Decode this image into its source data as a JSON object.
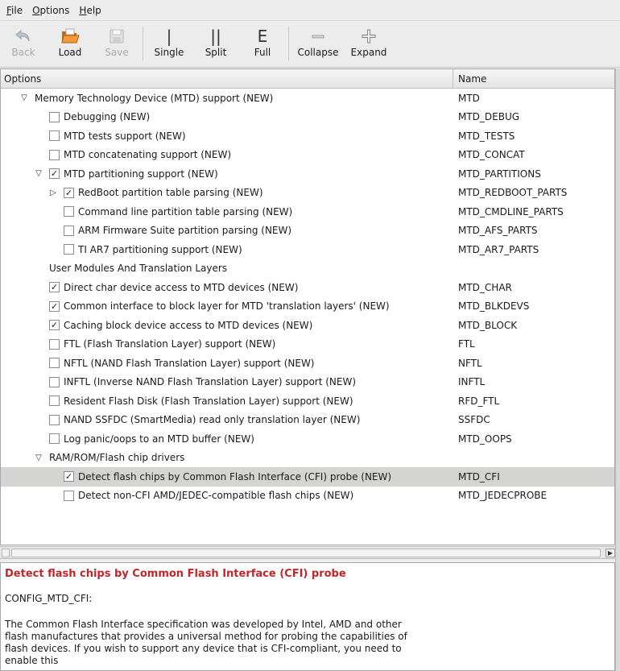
{
  "menubar": {
    "items": [
      {
        "pre": "",
        "u": "F",
        "post": "ile"
      },
      {
        "pre": "",
        "u": "O",
        "post": "ptions"
      },
      {
        "pre": "",
        "u": "H",
        "post": "elp"
      }
    ]
  },
  "toolbar": {
    "back": "Back",
    "load": "Load",
    "save": "Save",
    "single": "Single",
    "split": "Split",
    "full": "Full",
    "collapse": "Collapse",
    "expand": "Expand"
  },
  "tree": {
    "col_options": "Options",
    "col_name": "Name",
    "rows": [
      {
        "label": "Memory Technology Device (MTD) support (NEW)",
        "name": "MTD",
        "indent": 0,
        "expander": "down",
        "checkbox": "none"
      },
      {
        "label": "Debugging (NEW)",
        "name": "MTD_DEBUG",
        "indent": 1,
        "expander": "none",
        "checkbox": "unchecked"
      },
      {
        "label": "MTD tests support (NEW)",
        "name": "MTD_TESTS",
        "indent": 1,
        "expander": "none",
        "checkbox": "unchecked"
      },
      {
        "label": "MTD concatenating support (NEW)",
        "name": "MTD_CONCAT",
        "indent": 1,
        "expander": "none",
        "checkbox": "unchecked"
      },
      {
        "label": "MTD partitioning support (NEW)",
        "name": "MTD_PARTITIONS",
        "indent": 1,
        "expander": "down",
        "checkbox": "checked"
      },
      {
        "label": "RedBoot partition table parsing (NEW)",
        "name": "MTD_REDBOOT_PARTS",
        "indent": 2,
        "expander": "right",
        "checkbox": "checked"
      },
      {
        "label": "Command line partition table parsing (NEW)",
        "name": "MTD_CMDLINE_PARTS",
        "indent": 2,
        "expander": "none",
        "checkbox": "unchecked"
      },
      {
        "label": "ARM Firmware Suite partition parsing (NEW)",
        "name": "MTD_AFS_PARTS",
        "indent": 2,
        "expander": "none",
        "checkbox": "unchecked"
      },
      {
        "label": "TI AR7 partitioning support (NEW)",
        "name": "MTD_AR7_PARTS",
        "indent": 2,
        "expander": "none",
        "checkbox": "unchecked"
      },
      {
        "label": "User Modules And Translation Layers",
        "name": "",
        "indent": 1,
        "expander": "none",
        "checkbox": "none"
      },
      {
        "label": "Direct char device access to MTD devices (NEW)",
        "name": "MTD_CHAR",
        "indent": 1,
        "expander": "none",
        "checkbox": "checked"
      },
      {
        "label": "Common interface to block layer for MTD 'translation layers' (NEW)",
        "name": "MTD_BLKDEVS",
        "indent": 1,
        "expander": "none",
        "checkbox": "checked"
      },
      {
        "label": "Caching block device access to MTD devices (NEW)",
        "name": "MTD_BLOCK",
        "indent": 1,
        "expander": "none",
        "checkbox": "checked"
      },
      {
        "label": "FTL (Flash Translation Layer) support (NEW)",
        "name": "FTL",
        "indent": 1,
        "expander": "none",
        "checkbox": "unchecked"
      },
      {
        "label": "NFTL (NAND Flash Translation Layer) support (NEW)",
        "name": "NFTL",
        "indent": 1,
        "expander": "none",
        "checkbox": "unchecked"
      },
      {
        "label": "INFTL (Inverse NAND Flash Translation Layer) support (NEW)",
        "name": "INFTL",
        "indent": 1,
        "expander": "none",
        "checkbox": "unchecked"
      },
      {
        "label": "Resident Flash Disk (Flash Translation Layer) support (NEW)",
        "name": "RFD_FTL",
        "indent": 1,
        "expander": "none",
        "checkbox": "unchecked"
      },
      {
        "label": "NAND SSFDC (SmartMedia) read only translation layer (NEW)",
        "name": "SSFDC",
        "indent": 1,
        "expander": "none",
        "checkbox": "unchecked"
      },
      {
        "label": "Log panic/oops to an MTD buffer (NEW)",
        "name": "MTD_OOPS",
        "indent": 1,
        "expander": "none",
        "checkbox": "unchecked"
      },
      {
        "label": "RAM/ROM/Flash chip drivers",
        "name": "",
        "indent": 1,
        "expander": "down",
        "checkbox": "none"
      },
      {
        "label": "Detect flash chips by Common Flash Interface (CFI) probe (NEW)",
        "name": "MTD_CFI",
        "indent": 2,
        "expander": "none",
        "checkbox": "checked",
        "selected": true
      },
      {
        "label": "Detect non-CFI AMD/JEDEC-compatible flash chips (NEW)",
        "name": "MTD_JEDECPROBE",
        "indent": 2,
        "expander": "none",
        "checkbox": "unchecked"
      }
    ]
  },
  "help": {
    "title": "Detect flash chips by Common Flash Interface (CFI) probe",
    "config": "CONFIG_MTD_CFI:",
    "body": "The Common Flash Interface specification was developed by Intel, AMD and other flash manufactures that provides a universal method for probing the capabilities of flash devices. If you wish to support any device that is CFI-compliant, you need to enable this"
  },
  "colors": {
    "help_title": "#c0262b",
    "selected_row": "#d6d4d2",
    "load_icon": "#e07b1a"
  }
}
